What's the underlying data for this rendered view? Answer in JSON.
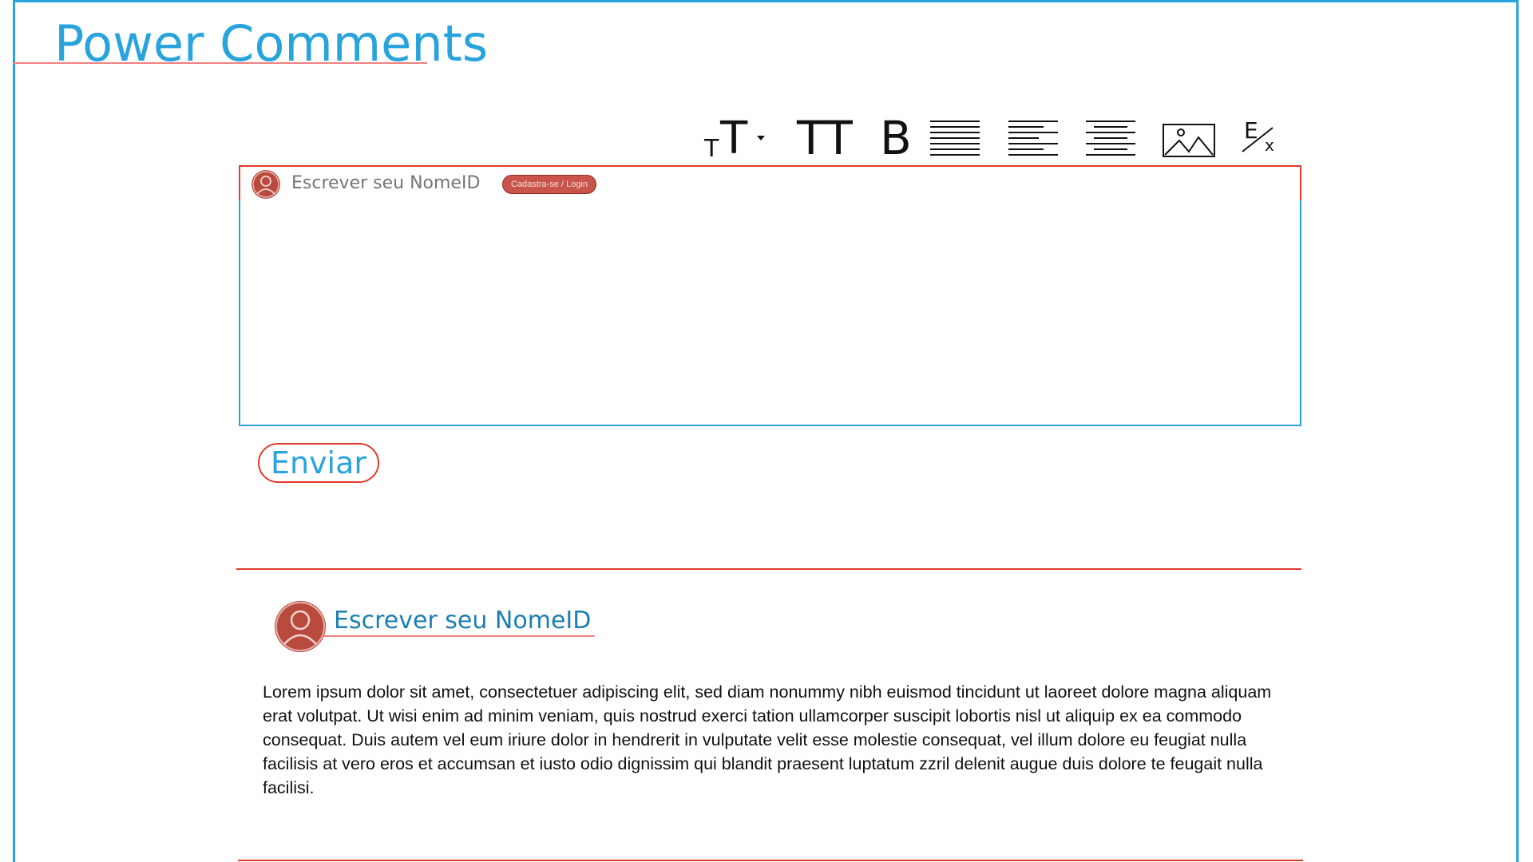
{
  "app": {
    "title": "Power Comments"
  },
  "toolbar": {
    "font_size_small": "T",
    "font_size_large": "T",
    "uppercase": "TT",
    "bold": "B",
    "clear_format_letter": "E",
    "clear_format_sub": "x",
    "icons": [
      "font-size-dropdown-icon",
      "uppercase-icon",
      "bold-icon",
      "align-justify-icon",
      "align-left-icon",
      "align-center-icon",
      "insert-image-icon",
      "clear-formatting-icon"
    ]
  },
  "editor": {
    "name_placeholder": "Escrever seu NomeID",
    "login_label": "Cadastra-se / Login",
    "body_value": ""
  },
  "actions": {
    "send_label": "Enviar"
  },
  "comments": [
    {
      "author": "Escrever seu NomeID",
      "text": "Lorem ipsum dolor sit amet, consectetuer adipiscing elit, sed diam nonummy nibh euismod tincidunt ut laoreet dolore magna aliquam erat volutpat. Ut wisi enim ad minim veniam, quis nostrud exerci tation ullamcorper suscipit lobortis nisl ut aliquip ex ea commodo consequat. Duis autem vel eum iriure dolor in hendrerit in vulputate velit esse molestie consequat, vel illum dolore eu feugiat nulla facilisis at vero eros et accumsan et iusto odio dignissim qui blandit praesent luptatum zzril delenit augue duis dolore te feugait nulla facilisi."
    }
  ],
  "colors": {
    "accent_blue": "#29a3dc",
    "name_blue": "#1c7fb0",
    "accent_red": "#e23a2c",
    "avatar_red": "#b84a3e"
  }
}
